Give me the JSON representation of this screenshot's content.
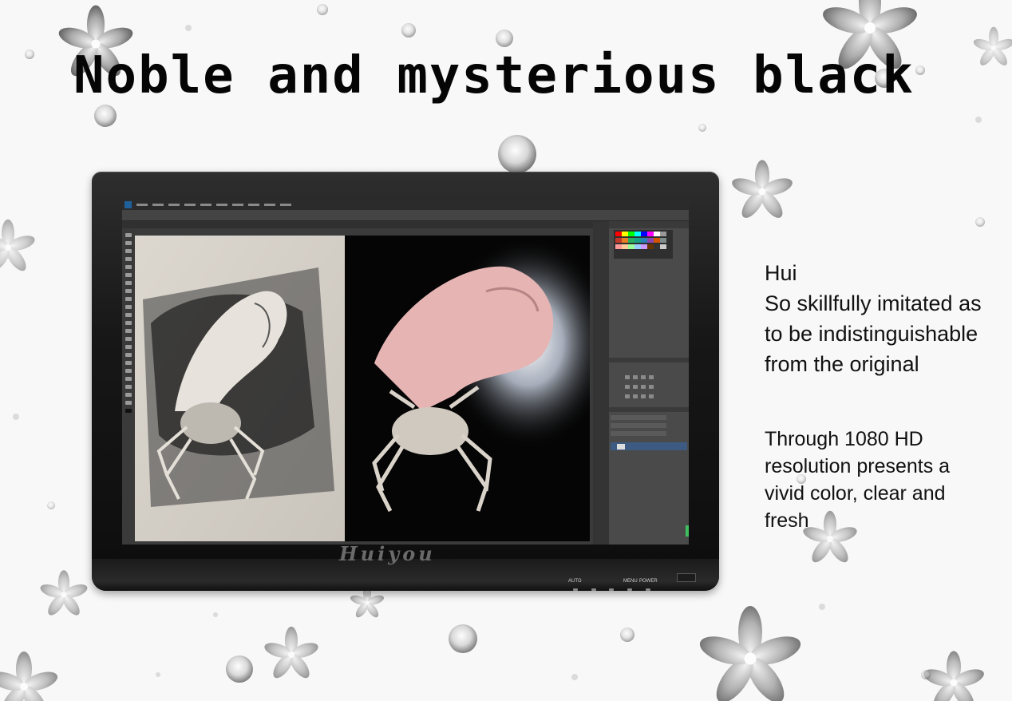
{
  "headline": "Noble and mysterious black",
  "monitor": {
    "brand_logo": "Huiyou",
    "buttons": [
      "AUTO",
      "MENU",
      "POWER"
    ],
    "screen_content": "photo-editor-sketch-and-photo-of-crab"
  },
  "feature_text": {
    "block1": [
      "Hui",
      "So skillfully imitated as",
      "to be indistinguishable",
      "from the original"
    ],
    "block2": [
      "Through 1080 HD",
      "resolution presents a",
      "vivid color, clear and",
      "fresh"
    ]
  },
  "colors": {
    "headline": "#050505",
    "bezel": "#111111",
    "text": "#111111",
    "background": "#f7f7f7"
  }
}
